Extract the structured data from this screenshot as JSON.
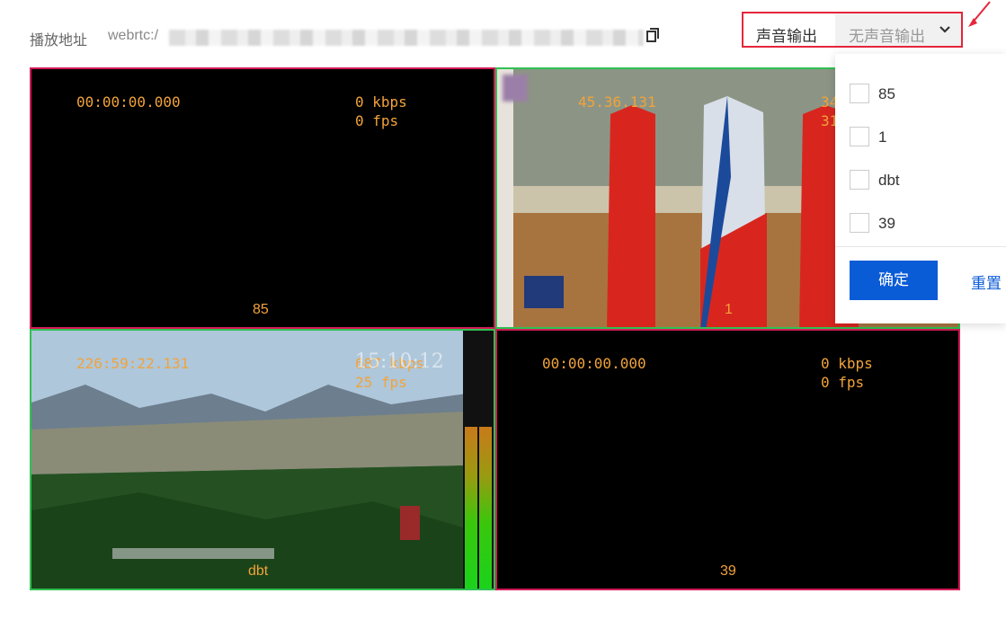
{
  "toolbar": {
    "play_label": "播放地址",
    "url_prefix": "webrtc:/",
    "audio_output_label": "声音输出",
    "audio_select_value": "无声音输出"
  },
  "tiles": [
    {
      "timestamp": "00:00:00.000",
      "bitrate": "0 kbps",
      "fps": "0 fps",
      "name": "85"
    },
    {
      "timestamp": "45.36.131",
      "bitrate": "34",
      "fps": "31",
      "name": "1"
    },
    {
      "timestamp": "226:59:22.131",
      "bitrate": "687 kbps",
      "fps": "25 fps",
      "name": "dbt",
      "overlay_time": "15:10:12"
    },
    {
      "timestamp": "00:00:00.000",
      "bitrate": "0 kbps",
      "fps": "0 fps",
      "name": "39"
    }
  ],
  "dropdown": {
    "options": [
      "85",
      "1",
      "dbt",
      "39"
    ],
    "confirm": "确定",
    "reset": "重置"
  },
  "colors": {
    "active_border": "#2fc152",
    "inactive_border": "#d21b56",
    "overlay_text": "#f2a33a",
    "primary": "#0a5bd6",
    "highlight": "#e5263b"
  }
}
